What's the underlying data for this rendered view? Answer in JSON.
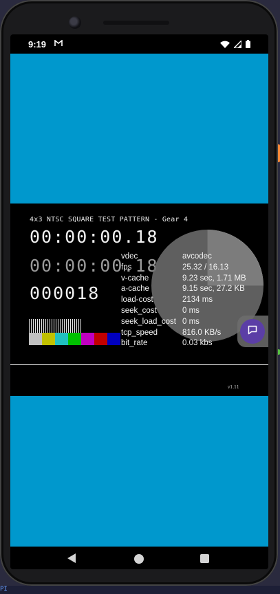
{
  "status_bar": {
    "time": "9:19",
    "notification_icon": "gmail-icon",
    "icons": [
      "wifi-icon",
      "cell-signal-icon",
      "battery-icon"
    ]
  },
  "video": {
    "pattern_title": "4x3 NTSC SQUARE TEST PATTERN - Gear 4",
    "timecode_1": "00:00:00.18",
    "timecode_2": "00:00:00.18",
    "frame_counter": "000018",
    "swatch_colors": [
      "#c0c0c0",
      "#c0c000",
      "#20c0c0",
      "#00c000",
      "#c000c0",
      "#c00000",
      "#0000c0"
    ],
    "version": "v1.11"
  },
  "stats": [
    {
      "key": "vdec",
      "value": "avcodec"
    },
    {
      "key": "fps",
      "value": "25.32 / 16.13"
    },
    {
      "key": "v-cache",
      "value": "9.23 sec, 1.71 MB"
    },
    {
      "key": "a-cache",
      "value": "9.15 sec, 27.2 KB"
    },
    {
      "key": "load-cost",
      "value": "2134 ms"
    },
    {
      "key": "seek_cost",
      "value": "0 ms"
    },
    {
      "key": "seek_load_cost",
      "value": "0 ms"
    },
    {
      "key": "tcp_speed",
      "value": "816.0 KB/s"
    },
    {
      "key": "bit_rate",
      "value": "0.03 kbs"
    }
  ],
  "fab": {
    "icon": "chat-bubble-icon"
  },
  "nav_bar": {
    "icons": [
      "back-icon",
      "home-icon",
      "recents-icon"
    ]
  },
  "colors": {
    "app_background": "#0098cd",
    "fab": "#5b3ea6"
  },
  "desktop_fragment": "PI"
}
